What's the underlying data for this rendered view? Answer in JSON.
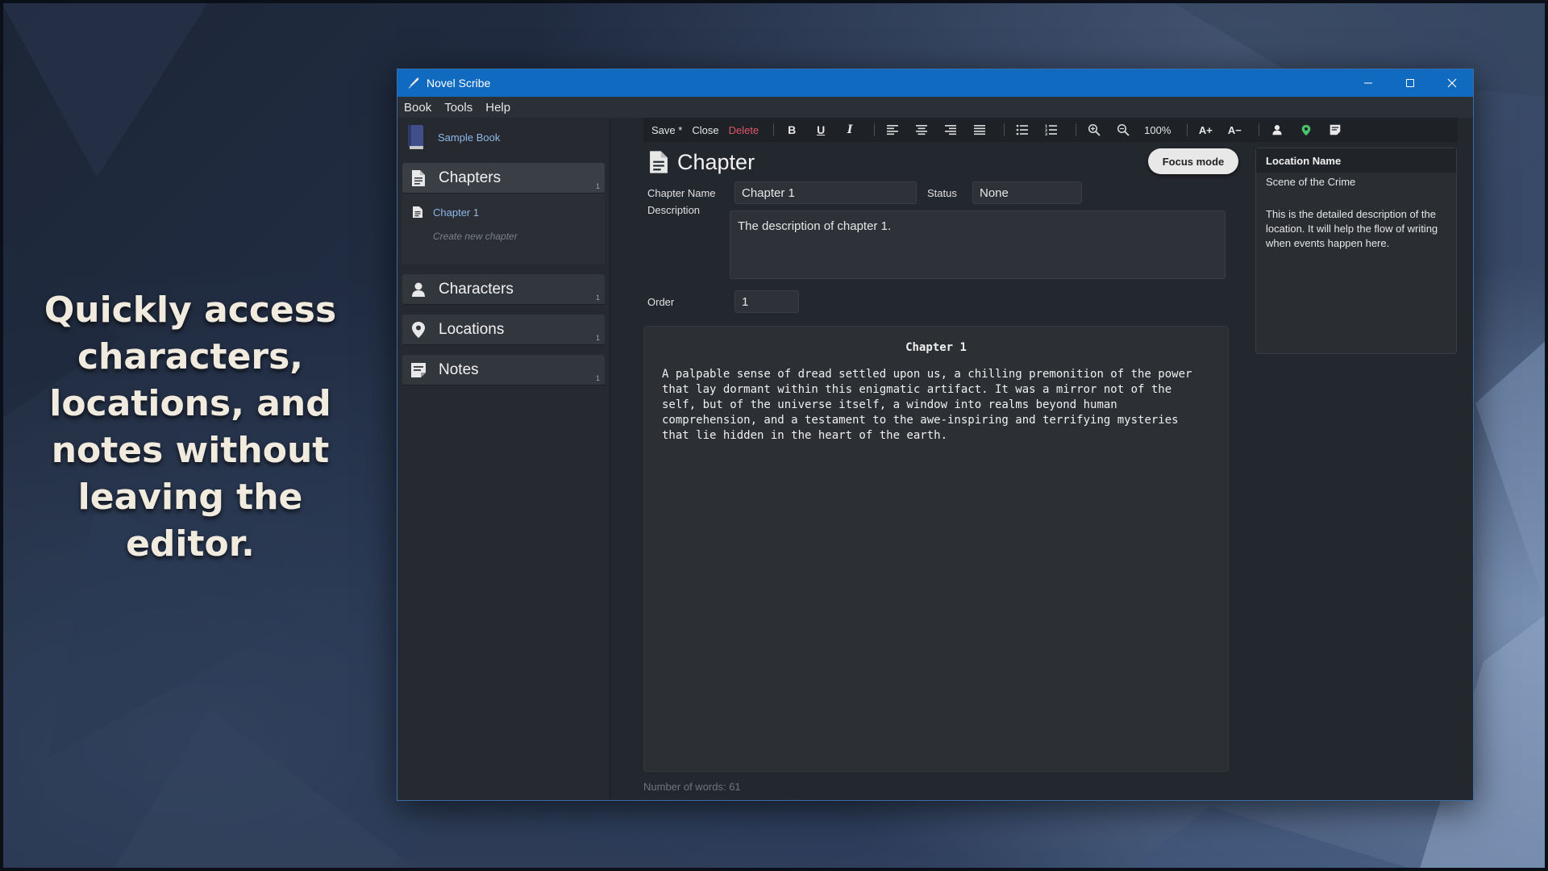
{
  "promo": {
    "line1": "Quickly access",
    "line2": "characters,",
    "line3": "locations, and",
    "line4": "notes without",
    "line5": "leaving the editor."
  },
  "window": {
    "title": "Novel Scribe",
    "app_icon": "quill-icon",
    "controls": [
      "minimize-icon",
      "maximize-icon",
      "close-icon"
    ]
  },
  "menu": {
    "book": "Book",
    "tools": "Tools",
    "help": "Help"
  },
  "sidebar": {
    "book_title": "Sample Book",
    "chapters": {
      "label": "Chapters",
      "count": "1"
    },
    "chapter_items": [
      {
        "label": "Chapter 1"
      }
    ],
    "create_chapter": "Create new chapter",
    "characters": {
      "label": "Characters",
      "count": "1"
    },
    "locations": {
      "label": "Locations",
      "count": "1"
    },
    "notes": {
      "label": "Notes",
      "count": "1"
    }
  },
  "toolbar": {
    "save": "Save *",
    "close": "Close",
    "delete": "Delete",
    "zoom": "100%",
    "font_larger": "A+",
    "font_smaller": "A−",
    "delete_color": "#e0566a"
  },
  "editor": {
    "title": "Chapter",
    "focus_mode": "Focus mode",
    "chapter_name_label": "Chapter Name",
    "chapter_name_value": "Chapter 1",
    "status_label": "Status",
    "status_value": "None",
    "description_label": "Description",
    "description_value": "The description of chapter 1.",
    "order_label": "Order",
    "order_value": "1",
    "text_heading": "Chapter 1",
    "text_body": "A palpable sense of dread settled upon us, a chilling premonition of the power that lay dormant within this enigmatic artifact. It was a mirror not of the self, but of the universe itself, a window into realms beyond human comprehension, and a testament to the awe-inspiring and terrifying mysteries that lie hidden in the heart of the earth.",
    "word_count": "Number of words: 61"
  },
  "location_panel": {
    "header": "Location Name",
    "name": "Scene of the Crime",
    "description": "This is the detailed description of the location. It will help the flow of writing when events happen here."
  },
  "colors": {
    "titlebar": "#0f6ac0",
    "link": "#8eb8e8",
    "background": "#23272e"
  }
}
